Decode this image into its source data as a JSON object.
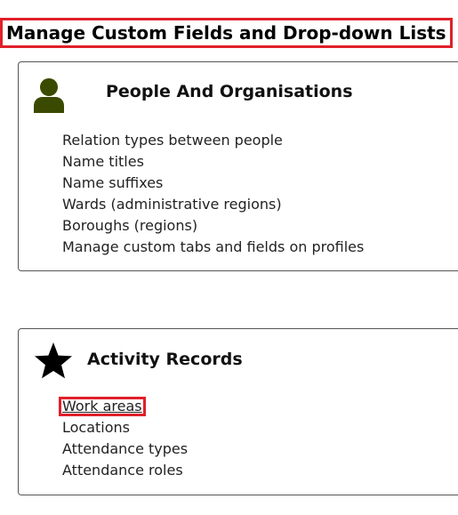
{
  "page": {
    "title": "Manage Custom Fields and Drop-down Lists"
  },
  "sections": [
    {
      "title": "People And Organisations",
      "icon": "person-icon",
      "icon_color": "#3a4a00",
      "links": [
        "Relation types between people",
        "Name titles",
        "Name suffixes",
        "Wards (administrative regions)",
        "Boroughs (regions)",
        "Manage custom tabs and fields on profiles"
      ]
    },
    {
      "title": "Activity Records",
      "icon": "star-icon",
      "icon_color": "#000000",
      "links": [
        "Work areas",
        "Locations",
        "Attendance types",
        "Attendance roles"
      ]
    }
  ],
  "highlight_color": "#e0202a"
}
